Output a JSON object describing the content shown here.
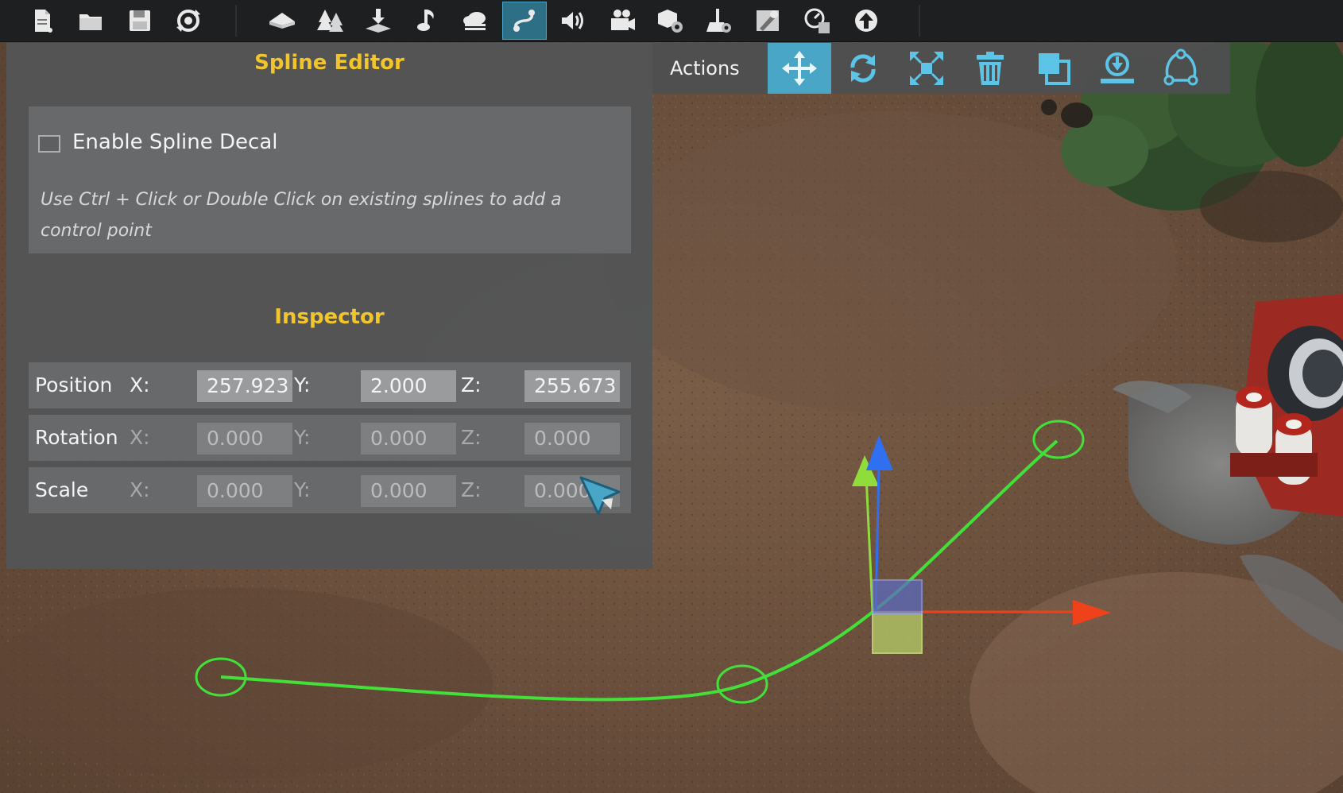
{
  "toolbar": {
    "icons": [
      "new-file-icon",
      "open-folder-icon",
      "save-icon",
      "refresh-icon",
      "terrain-icon",
      "trees-icon",
      "terrain-stamp-icon",
      "music-icon",
      "cloud-icon",
      "spline-icon",
      "speaker-icon",
      "camera-icon",
      "objects-settings-icon",
      "document-settings-icon",
      "tools-icon",
      "performance-icon",
      "upload-icon"
    ],
    "active": "spline-icon",
    "accent": "#4aa6c6"
  },
  "spline_editor": {
    "title": "Spline Editor",
    "enable_decal_label": "Enable Spline Decal",
    "enable_decal_checked": false,
    "hint": "Use Ctrl + Click or Double Click on existing splines to add a control point"
  },
  "inspector": {
    "title": "Inspector",
    "position": {
      "label": "Position",
      "x_label": "X:",
      "y_label": "Y:",
      "z_label": "Z:",
      "x": "257.923",
      "y": "2.000",
      "z": "255.673"
    },
    "rotation": {
      "label": "Rotation",
      "x_label": "X:",
      "y_label": "Y:",
      "z_label": "Z:",
      "x": "0.000",
      "y": "0.000",
      "z": "0.000"
    },
    "scale": {
      "label": "Scale",
      "x_label": "X:",
      "y_label": "Y:",
      "z_label": "Z:",
      "x": "0.000",
      "y": "0.000",
      "z": "0.000"
    }
  },
  "actions": {
    "label": "Actions",
    "buttons": [
      "move-icon",
      "rotate-icon",
      "scale-icon",
      "delete-icon",
      "duplicate-icon",
      "snap-to-ground-icon",
      "spline-nodes-icon"
    ],
    "active": "move-icon"
  },
  "colors": {
    "title_yellow": "#f2c62b",
    "spline_green": "#43e03a",
    "gizmo_x": "#f0421a",
    "gizmo_y": "#8fdc3a",
    "gizmo_z": "#2f6ff0"
  }
}
